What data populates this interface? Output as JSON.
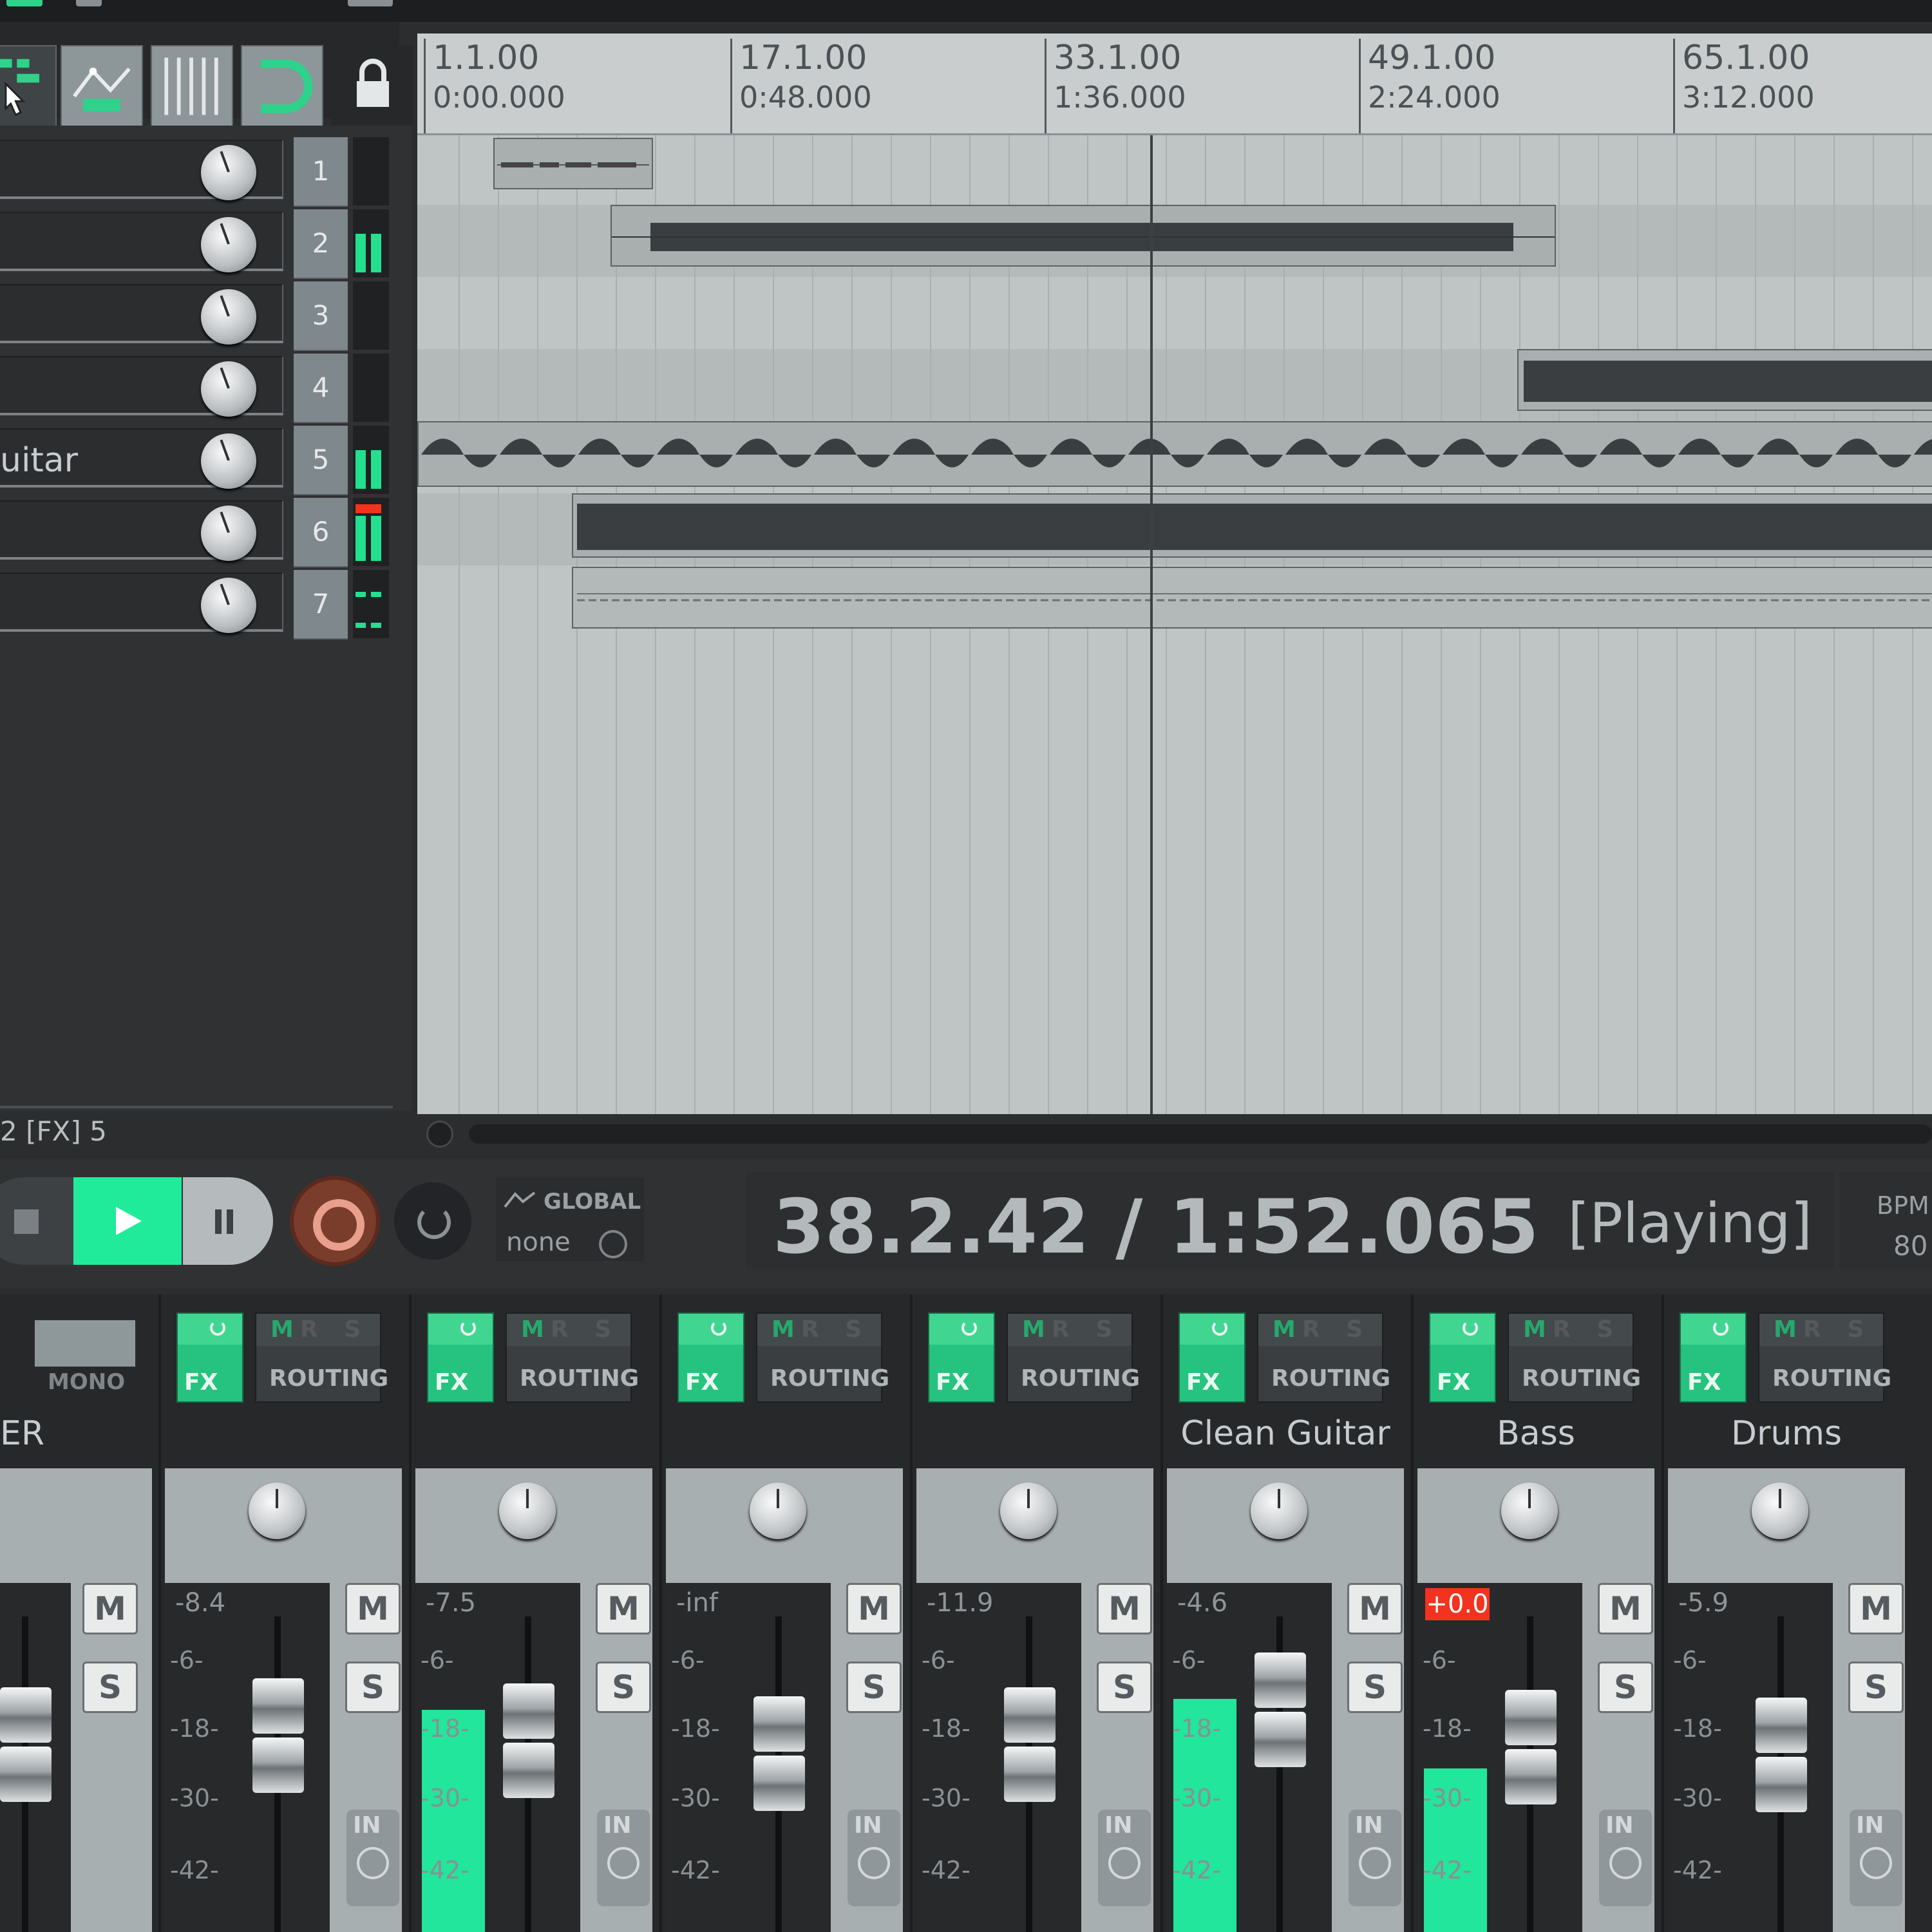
{
  "toolbar": {
    "icons": [
      "item-grouping-icon",
      "envelope-points-icon",
      "grid-snap-icon",
      "ripple-magnet-icon",
      "lock-icon"
    ]
  },
  "tracks": [
    {
      "number": "1",
      "name": ""
    },
    {
      "number": "2",
      "name": ""
    },
    {
      "number": "3",
      "name": ""
    },
    {
      "number": "4",
      "name": ""
    },
    {
      "number": "5",
      "name": "uitar"
    },
    {
      "number": "6",
      "name": ""
    },
    {
      "number": "7",
      "name": ""
    }
  ],
  "ruler": {
    "marks": [
      {
        "bar": "1.1.00",
        "time": "0:00.000"
      },
      {
        "bar": "17.1.00",
        "time": "0:48.000"
      },
      {
        "bar": "33.1.00",
        "time": "1:36.000"
      },
      {
        "bar": "49.1.00",
        "time": "2:24.000"
      },
      {
        "bar": "65.1.00",
        "time": "3:12.000"
      }
    ]
  },
  "status_line": "2 [FX] 5",
  "transport": {
    "automation_label": "GLOBAL",
    "automation_mode": "none",
    "position": "38.2.42 / 1:52.065",
    "state": "[Playing]",
    "bpm_label": "BPM",
    "bpm_value": "80"
  },
  "mixer": {
    "master": {
      "name": "ER",
      "mono_label": "MONO"
    },
    "fx_label": "FX",
    "routing_label": "ROUTING",
    "routing_flags": {
      "m": "M",
      "rs": "R S"
    },
    "mute_label": "M",
    "solo_label": "S",
    "input_label": "IN",
    "scale": [
      "-6-",
      "-18-",
      "-30-",
      "-42-"
    ],
    "channels": [
      {
        "name": "",
        "peak": "-8.4",
        "meter_level": 0
      },
      {
        "name": "",
        "peak": "-7.5",
        "meter_level": 0.58
      },
      {
        "name": "",
        "peak": "-inf",
        "meter_level": 0
      },
      {
        "name": "",
        "peak": "-11.9",
        "meter_level": 0
      },
      {
        "name": "Clean Guitar",
        "peak": "-4.6",
        "meter_level": 0.6
      },
      {
        "name": "Bass",
        "peak": "+0.0",
        "meter_level": 0.46,
        "clipped": true
      },
      {
        "name": "Drums",
        "peak": "-5.9",
        "meter_level": 0
      }
    ]
  },
  "colors": {
    "accent_green": "#20eb9a",
    "clip_red": "#f2331f",
    "record": "#7a3c2b"
  }
}
